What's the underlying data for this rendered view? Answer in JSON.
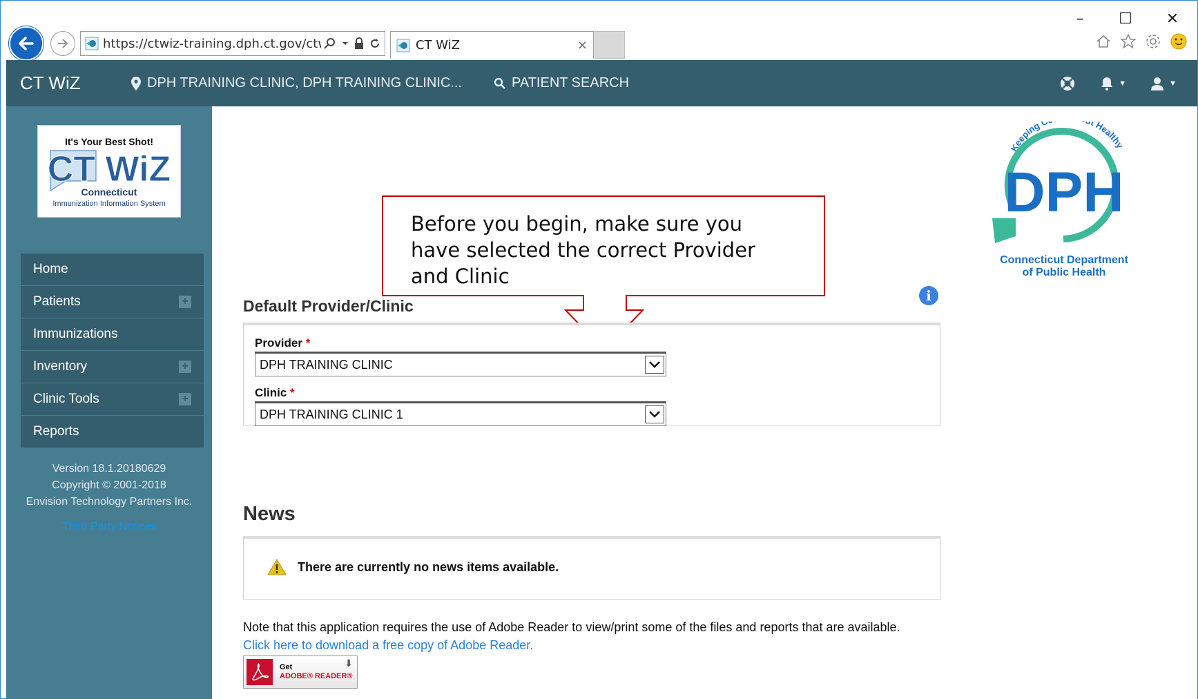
{
  "browser": {
    "url": "https://ctwiz-training.dph.ct.gov/ctwi",
    "tab_title": "CT WiZ",
    "tab_close": "×",
    "win_minimize": "–",
    "win_maximize": "☐",
    "win_close": "✕"
  },
  "navbar": {
    "brand": "CT WiZ",
    "clinic_selector": "DPH TRAINING CLINIC, DPH TRAINING CLINIC...",
    "patient_search": "PATIENT SEARCH"
  },
  "sidebar": {
    "logo": {
      "tagline": "It's Your Best Shot!",
      "name": "CT WiZ",
      "state": "Connecticut",
      "subtitle": "Immunization Information System"
    },
    "items": [
      {
        "label": "Home",
        "expandable": false
      },
      {
        "label": "Patients",
        "expandable": true
      },
      {
        "label": "Immunizations",
        "expandable": false
      },
      {
        "label": "Inventory",
        "expandable": true
      },
      {
        "label": "Clinic Tools",
        "expandable": true
      },
      {
        "label": "Reports",
        "expandable": false
      }
    ],
    "version": "Version 18.1.20180629",
    "copyright": "Copyright © 2001-2018",
    "company": "Envision Technology Partners Inc.",
    "third_party": "Third Party Notices"
  },
  "callout": {
    "line1": "Before you begin, make sure  you",
    "line2": "have selected the correct Provider",
    "line3": "and Clinic"
  },
  "dph_logo": {
    "arc_text": "Keeping Connecticut Healthy",
    "letters": "DPH",
    "line1": "Connecticut Department",
    "line2": "of Public Health"
  },
  "default_section": {
    "title": "Default Provider/Clinic",
    "provider_label": "Provider",
    "provider_value": "DPH TRAINING CLINIC",
    "clinic_label": "Clinic",
    "clinic_value": "DPH TRAINING CLINIC 1",
    "required_mark": "*"
  },
  "news": {
    "title": "News",
    "empty_message": "There are currently no news items available."
  },
  "footer": {
    "note": "Note that this application requires the use of Adobe Reader to view/print some of the files and reports that are available.",
    "download_link": "Click here to download a free copy of Adobe Reader.",
    "adobe_get": "Get",
    "adobe_name": "ADOBE® READER®"
  },
  "colors": {
    "navbar": "#345e6e",
    "sidebar": "#477d90",
    "callout_border": "#c00000",
    "dph_blue": "#1a6fc4",
    "dph_teal": "#3cb89a"
  }
}
